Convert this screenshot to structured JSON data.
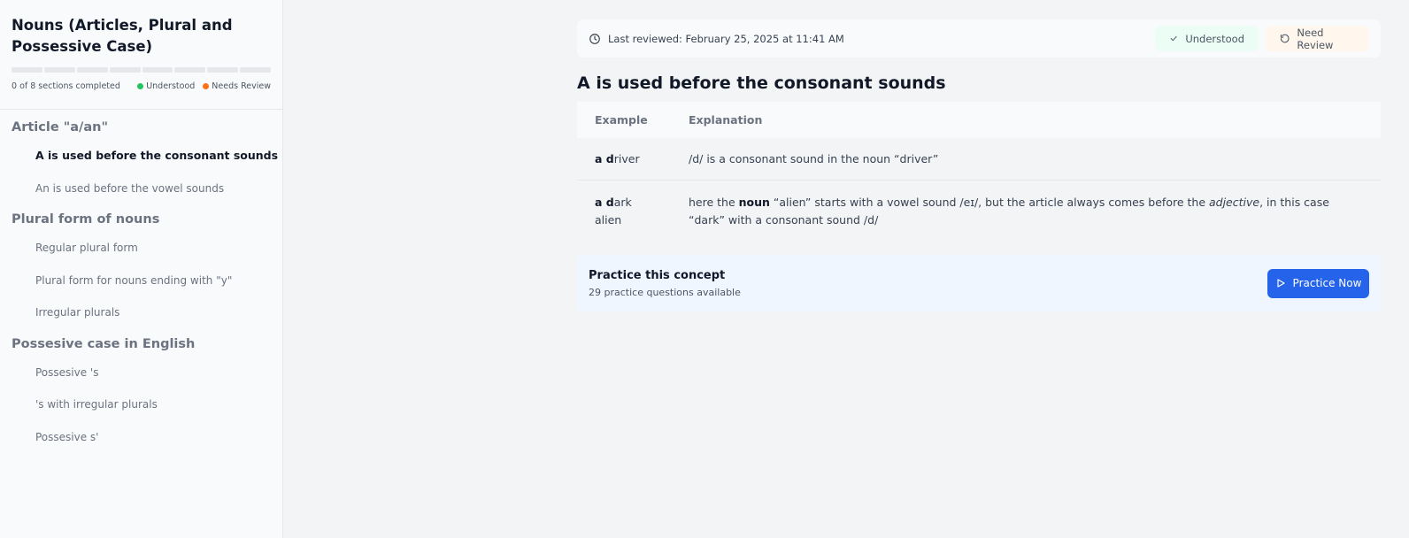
{
  "sidebar": {
    "title": "Nouns (Articles, Plural and Possessive Case)",
    "progress_completed": 0,
    "progress_total": 8,
    "progress_text": "0 of 8 sections completed",
    "legend_understood": "Understood",
    "legend_needs_review": "Needs Review",
    "colors": {
      "understood": "#22c55e",
      "needs_review": "#f97316"
    },
    "groups": [
      {
        "label": "Article \"a/an\"",
        "items": [
          {
            "label": "A is used before the consonant sounds",
            "active": true
          },
          {
            "label": "An is used before the vowel sounds",
            "active": false
          }
        ]
      },
      {
        "label": "Plural form of nouns",
        "items": [
          {
            "label": "Regular plural form",
            "active": false
          },
          {
            "label": "Plural form for nouns ending with \"y\"",
            "active": false
          },
          {
            "label": "Irregular plurals",
            "active": false
          }
        ]
      },
      {
        "label": "Possesive case in English",
        "items": [
          {
            "label": "Possesive 's",
            "active": false
          },
          {
            "label": "'s with irregular plurals",
            "active": false
          },
          {
            "label": "Possesive s'",
            "active": false
          }
        ]
      }
    ]
  },
  "main": {
    "last_reviewed": "Last reviewed: February 25, 2025 at 11:41 AM",
    "understood_label": "Understood",
    "need_review_label": "Need Review",
    "concept_title": "A is used before the consonant sounds",
    "table": {
      "headers": [
        "Example",
        "Explanation"
      ],
      "rows": [
        {
          "example_bold": "a d",
          "example_rest": "river",
          "explanation": "/d/ is a consonant sound in the noun “driver”"
        },
        {
          "example_bold": "a d",
          "example_rest": "ark alien",
          "explanation_parts": [
            "here the ",
            "noun",
            " “alien” starts with a vowel sound /eɪ/, but the article always comes before the ",
            "adjective",
            ", in this case “dark” with a consonant sound /d/"
          ]
        }
      ]
    },
    "practice": {
      "title": "Practice this concept",
      "subtitle": "29 practice questions available",
      "button_label": "Practice Now",
      "button_color": "#2563eb"
    }
  },
  "icons": {
    "review_bar": "clock-icon",
    "understood": "check-icon",
    "need_review": "rotate-ccw-icon",
    "practice": "play-icon"
  }
}
